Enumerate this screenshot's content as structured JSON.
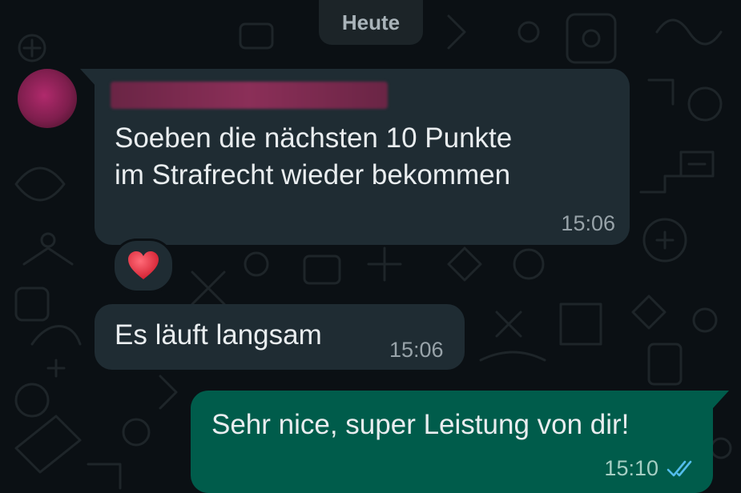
{
  "date_chip": "Heute",
  "messages": [
    {
      "direction": "incoming",
      "sender_hidden": true,
      "text": "Soeben die nächsten 10 Punkte\nim Strafrecht wieder bekommen",
      "time": "15:06",
      "reaction": "heart-icon"
    },
    {
      "direction": "incoming",
      "text": "Es läuft langsam",
      "time": "15:06"
    },
    {
      "direction": "outgoing",
      "text": "Sehr nice, super Leistung von dir!",
      "time": "15:10",
      "status": "read-double-check-icon"
    }
  ],
  "colors": {
    "background": "#0b1014",
    "incoming_bubble": "#1f2c33",
    "outgoing_bubble": "#005c4b",
    "read_ticks": "#53bdeb"
  }
}
